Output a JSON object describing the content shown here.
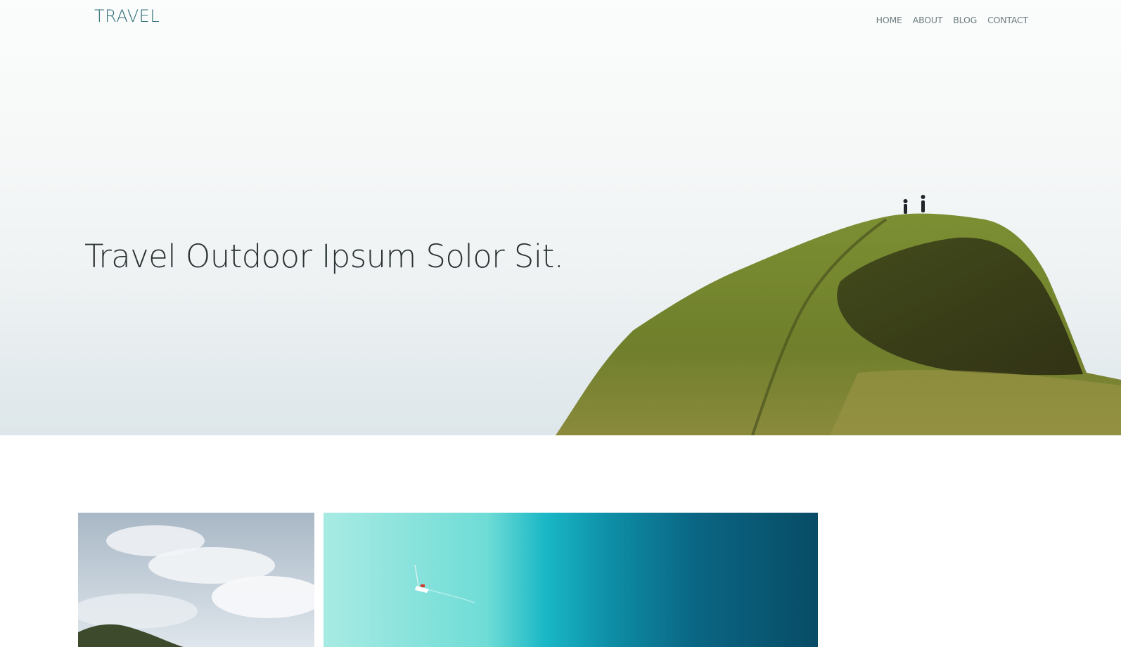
{
  "header": {
    "logo": "TRAVEL",
    "nav": [
      {
        "label": "HOME"
      },
      {
        "label": "ABOUT"
      },
      {
        "label": "BLOG"
      },
      {
        "label": "CONTACT"
      }
    ]
  },
  "hero": {
    "headline": "Travel Outdoor Ipsum Solor Sit."
  },
  "colors": {
    "brand": "#2f6f78",
    "headline": "#2a3234",
    "nav": "#6f7d80"
  },
  "gallery": {
    "tiles": [
      {
        "name": "cloudy-hill-photo"
      },
      {
        "name": "ocean-boat-photo"
      }
    ]
  }
}
